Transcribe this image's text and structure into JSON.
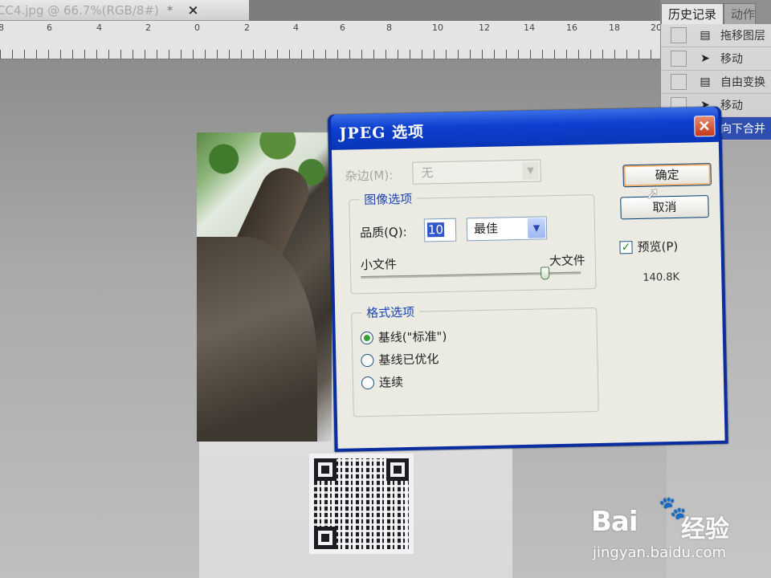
{
  "document_tab": {
    "title": "CC4.jpg @ 66.7%(RGB/8#)",
    "modified_marker": "*",
    "close_glyph": "×"
  },
  "ruler": {
    "labels": [
      "8",
      "6",
      "4",
      "2",
      "0",
      "2",
      "4",
      "6",
      "8",
      "10",
      "12",
      "14",
      "16",
      "18",
      "20"
    ]
  },
  "history_panel": {
    "tab_label": "历史记录",
    "tab2_label": "动作",
    "items": [
      {
        "label": "拖移图层",
        "icon": "layer-icon"
      },
      {
        "label": "移动",
        "icon": "move-icon"
      },
      {
        "label": "自由变换",
        "icon": "layer-icon"
      },
      {
        "label": "移动",
        "icon": "move-icon"
      },
      {
        "label": "向下合并",
        "icon": "layer-icon"
      }
    ]
  },
  "dialog": {
    "title": "JPEG 选项",
    "close_glyph": "✕",
    "matte_label": "杂边(M):",
    "matte_value": "无",
    "image_options_title": "图像选项",
    "quality_label": "品质(Q):",
    "quality_value": "10",
    "quality_preset": "最佳",
    "small_file_label": "小文件",
    "large_file_label": "大文件",
    "quality_slider_fraction": 0.83,
    "format_options_title": "格式选项",
    "format_options": [
      {
        "label": "基线(\"标准\")",
        "selected": true
      },
      {
        "label": "基线已优化",
        "selected": false
      },
      {
        "label": "连续",
        "selected": false
      }
    ],
    "ok_label": "确定",
    "cancel_label": "取消",
    "preview_label": "预览(P)",
    "preview_checked": true,
    "file_size": "140.8K"
  },
  "watermark": {
    "brand": "Bai",
    "brand2": "经验",
    "url": "jingyan.baidu.com"
  },
  "colors": {
    "title_bar": "#0e3fcf",
    "dialog_body": "#ecebe3",
    "group_title": "#1a44b8",
    "history_selected": "#2e4fb0"
  }
}
